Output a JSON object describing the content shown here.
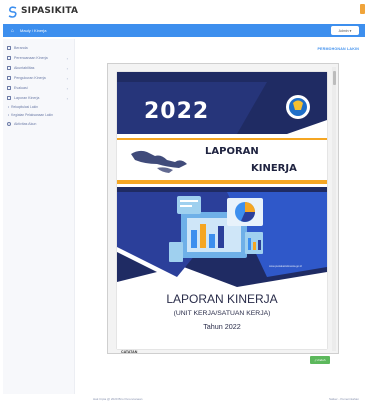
{
  "brand": {
    "name": "SIPASIKITA"
  },
  "navbar": {
    "breadcrumb": "Mauly / Kinerja",
    "user_label": "Admin"
  },
  "sidebar": {
    "items": [
      {
        "label": "Beranda",
        "icon": "home-icon",
        "chevron": ""
      },
      {
        "label": "Perencanaan Kinerja",
        "icon": "document-icon",
        "chevron": "›"
      },
      {
        "label": "Akuntabilitas",
        "icon": "chart-icon",
        "chevron": "›"
      },
      {
        "label": "Pengukuran Kinerja",
        "icon": "gauge-icon",
        "chevron": "›"
      },
      {
        "label": "Evaluasi",
        "icon": "grid-icon",
        "chevron": "›"
      },
      {
        "label": "Laporan Kinerja",
        "icon": "report-icon",
        "chevron": "›"
      }
    ],
    "subitems": [
      {
        "label": "Rekapitulasi Lakin"
      },
      {
        "label": "Kegiatan Pelaksanaan Lakin"
      }
    ],
    "extra": {
      "label": "Aktivitas Akun",
      "icon": "user-group-icon"
    }
  },
  "content": {
    "header": "PERMOHONAN LAKIN",
    "cover": {
      "year": "2022",
      "title_line1": "LAPORAN",
      "title_line2": "KINERJA",
      "website": "www.pustakaindonesia.go.id",
      "main_title": "LAPORAN KINERJA",
      "subtitle": "(UNIT KERJA/SATUAN KERJA)",
      "year_line": "Tahun 2022",
      "note_label": "CATATAN"
    },
    "download_label": "Unduh"
  },
  "footer": {
    "left": "Hak Cipta @ 2020 Biro Perencanaan",
    "right": "Satker - Pemerintahan"
  },
  "colors": {
    "navbar": "#3d8fee",
    "cover_navy": "#1f2b63",
    "cover_blue": "#2f58c9",
    "cover_orange": "#f5a623",
    "download": "#5cb85c"
  }
}
